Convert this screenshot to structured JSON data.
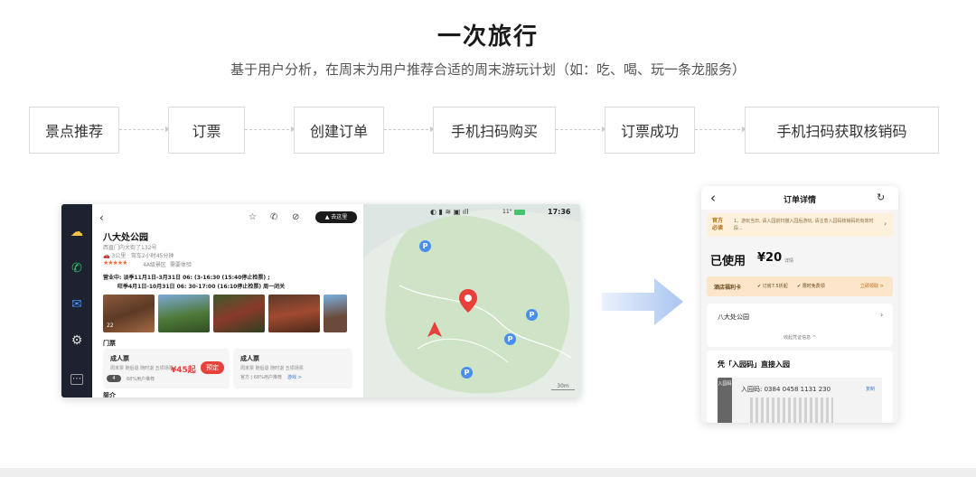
{
  "header": {
    "title": "一次旅行",
    "subtitle": "基于用户分析，在周末为用户推荐合适的周末游玩计划（如：吃、喝、玩一条龙服务）"
  },
  "flow_steps": [
    "景点推荐",
    "订票",
    "创建订单",
    "手机扫码购买",
    "订票成功",
    "手机扫码获取核销码"
  ],
  "car_screen": {
    "status": {
      "time": "17:36",
      "temp": "11°"
    },
    "back": "‹",
    "go_button": "▲ 去这里",
    "place_name": "八大处公园",
    "address": "西直门内大街了132号",
    "distance_line": "🚗 3公里 · 驾车2小时45分钟",
    "rating_text": "4A级景区",
    "rating_extra": "需要体验",
    "hours_line1": "营业中: 淡季11月1日-3月31日 06: (3-16:30 (15:40停止检票) ;",
    "hours_line2": "旺季4月1日-10月31日 06: 30-17:00 (16:10停止检票) 周一闭关",
    "photo_count": "22",
    "tickets_heading": "门票",
    "ticket1": {
      "name": "成人票",
      "desc": "周末票 随后退 随时退 五项场票",
      "sub": "68%用户推荐",
      "price": "¥45起",
      "book": "预定",
      "tag": "4"
    },
    "ticket2": {
      "name": "成人票",
      "desc": "周末票 随后退 随时退 五项场票",
      "sub": "官方 | 68%用户推荐",
      "link": "游戏 >"
    },
    "more_heading": "简介",
    "scale": "30m"
  },
  "phone": {
    "back": "‹",
    "title": "订单详情",
    "notice_tag": "官方 必读",
    "notice_text": "1、游玩当日, 请入园前扫描入园后游玩, 请注意入园码核销码的有效时段...",
    "used_label": "已使用",
    "price": "¥20",
    "price_suffix": "详情",
    "perks_label": "酒店福利卡",
    "perks_tags": [
      "✔ 订房7.5折起",
      "✔ 限时免费领"
    ],
    "perks_link": "立即领取 >",
    "park_name": "八大处公园",
    "collapse": "收起凭证信息 ^",
    "entry_title": "凭「入园码」直接入园",
    "entry_side": "入园码",
    "entry_code": "入园码: 0384 0458 1131 230",
    "copy": "复制"
  }
}
